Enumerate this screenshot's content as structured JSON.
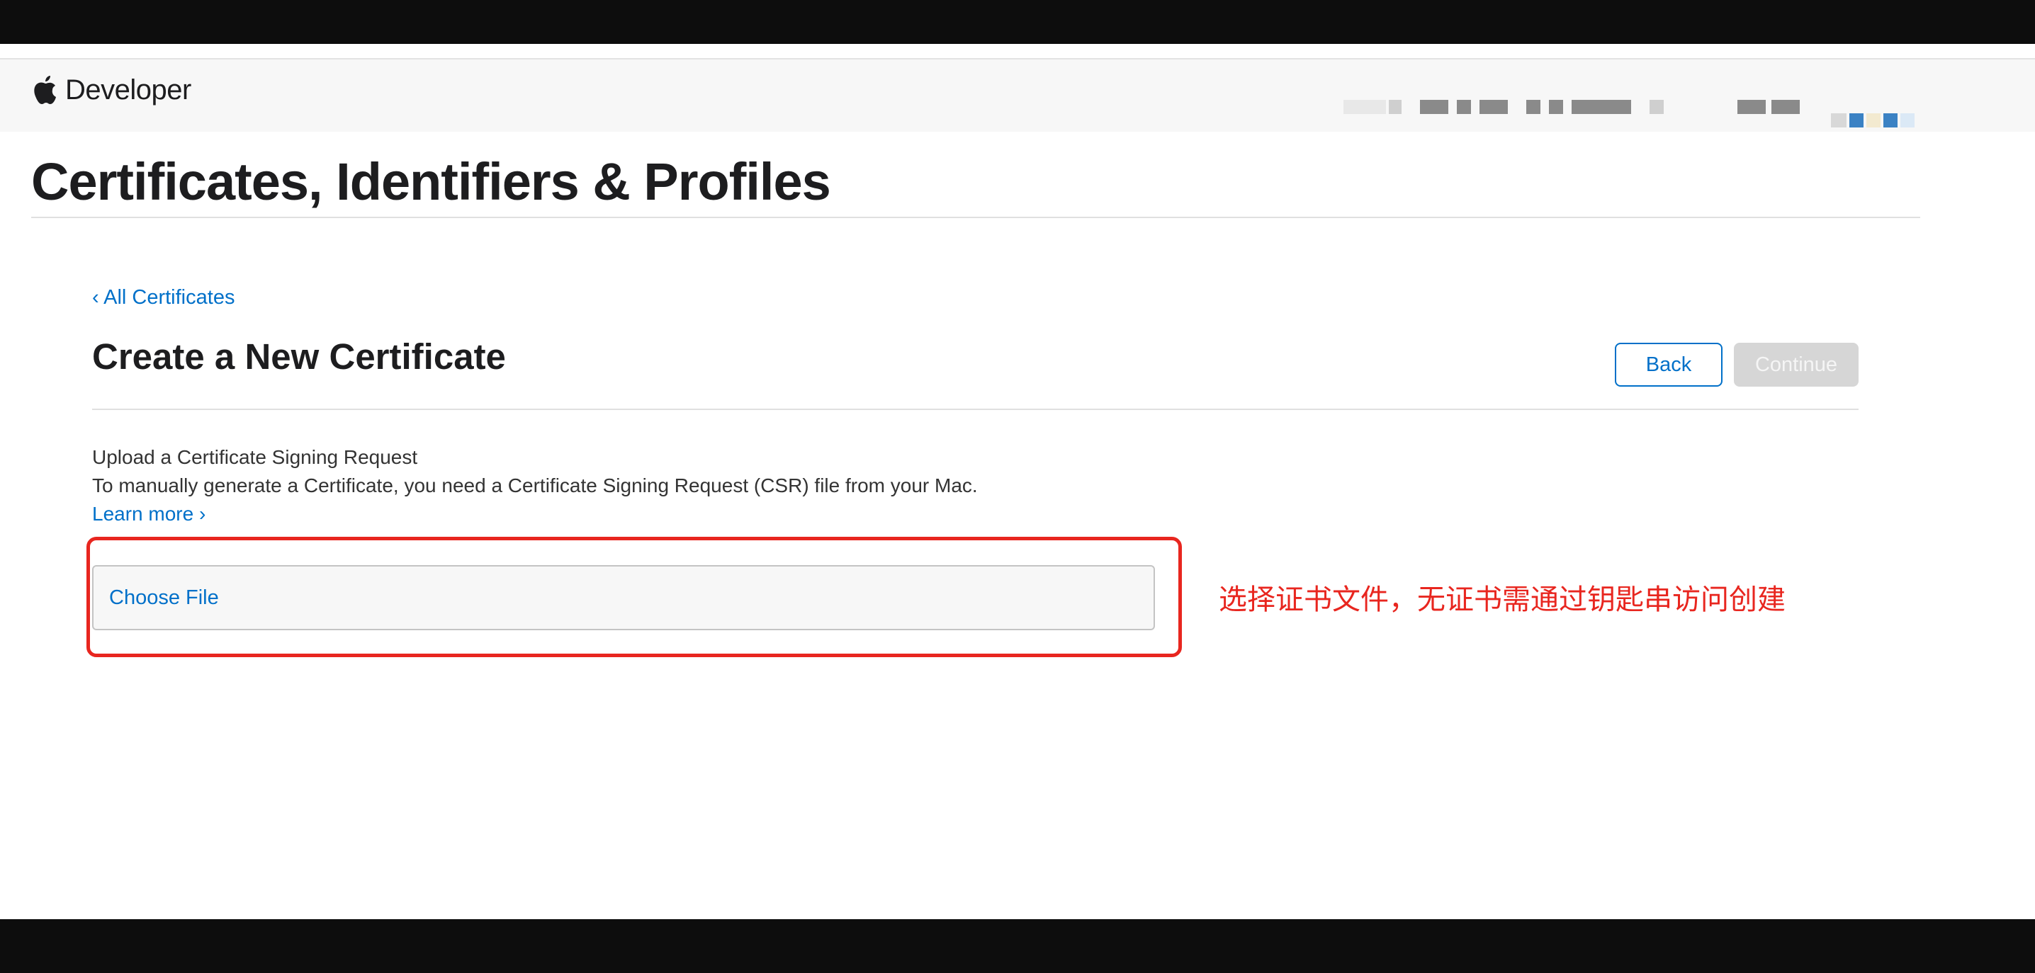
{
  "nav": {
    "brand_label": "Developer"
  },
  "page": {
    "title": "Certificates, Identifiers & Profiles"
  },
  "breadcrumb": {
    "back_link": "‹ All Certificates"
  },
  "section": {
    "title": "Create a New Certificate",
    "back_button": "Back",
    "continue_button": "Continue"
  },
  "upload": {
    "heading": "Upload a Certificate Signing Request",
    "description": "To manually generate a Certificate, you need a Certificate Signing Request (CSR) file from your Mac.",
    "learn_more": "Learn more ›",
    "choose_file": "Choose File"
  },
  "annotation": {
    "text": "选择证书文件，无证书需通过钥匙串访问创建",
    "color": "#e8261f"
  },
  "colors": {
    "link": "#0070c9",
    "button_disabled": "#d6d6d6",
    "frame": "#0d0d0d"
  },
  "icons": [
    "apple-logo-icon"
  ]
}
